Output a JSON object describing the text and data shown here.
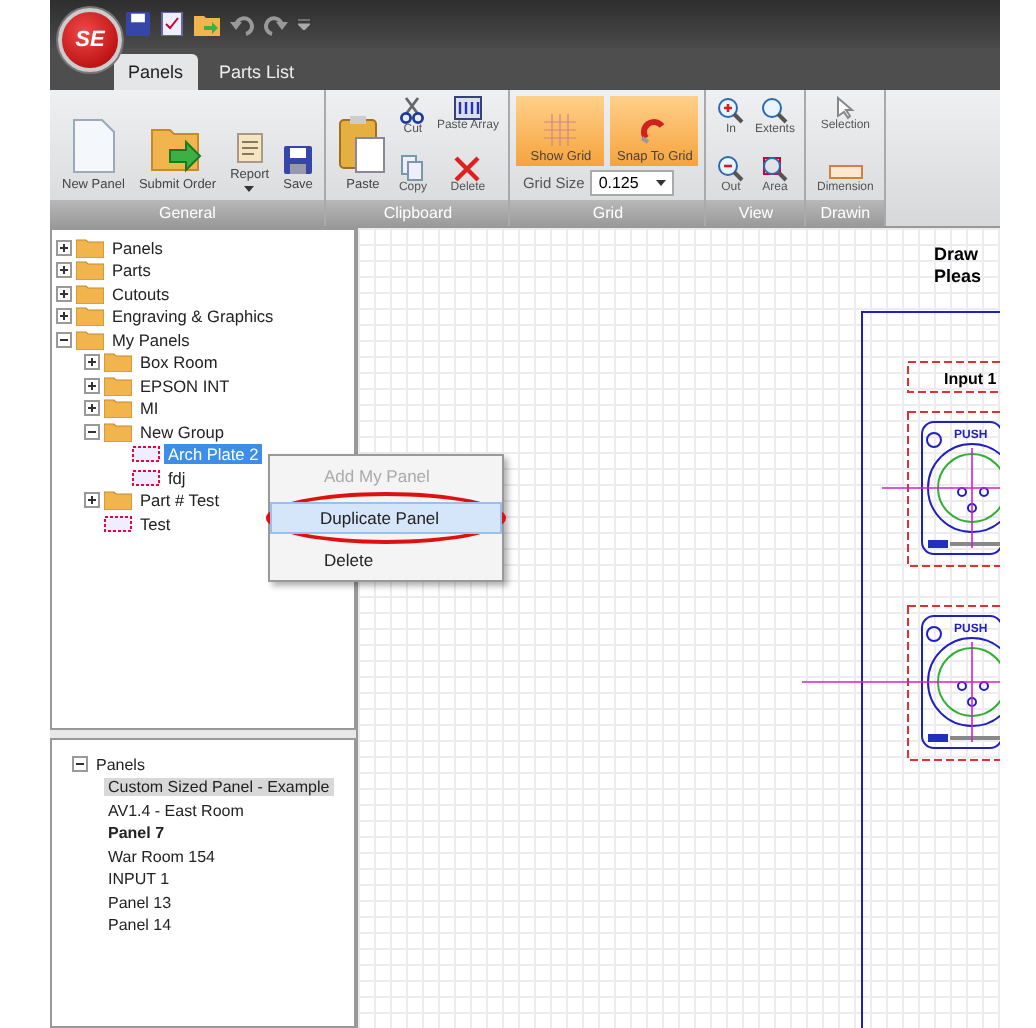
{
  "app": {
    "logo": "SE"
  },
  "ribbon_tabs": [
    {
      "label": "Panels",
      "selected": true
    },
    {
      "label": "Parts List",
      "selected": false
    }
  ],
  "ribbon_groups": [
    {
      "label": "General",
      "buttons": [
        {
          "label": "New Panel",
          "kind": "large"
        },
        {
          "label": "Submit Order",
          "kind": "large"
        },
        {
          "label": "Report",
          "kind": "menu"
        },
        {
          "label": "Save",
          "kind": "large"
        }
      ]
    },
    {
      "label": "Clipboard",
      "buttons": [
        {
          "label": "Paste",
          "kind": "large"
        },
        {
          "label": "Cut",
          "kind": "small"
        },
        {
          "label": "Copy",
          "kind": "small"
        },
        {
          "label": "Paste Array",
          "kind": "small"
        },
        {
          "label": "Delete",
          "kind": "small"
        }
      ]
    },
    {
      "label": "Grid",
      "buttons": [
        {
          "label": "Show Grid",
          "kind": "toggle",
          "on": true
        },
        {
          "label": "Snap To Grid",
          "kind": "toggle",
          "on": true
        }
      ],
      "grid_size": {
        "label": "Grid Size",
        "value": "0.125"
      }
    },
    {
      "label": "View",
      "buttons": [
        {
          "label": "In",
          "kind": "small"
        },
        {
          "label": "Out",
          "kind": "small"
        },
        {
          "label": "Extents",
          "kind": "small"
        },
        {
          "label": "Area",
          "kind": "small"
        }
      ]
    },
    {
      "label": "Drawin",
      "buttons": [
        {
          "label": "Selection",
          "kind": "small"
        },
        {
          "label": "Dimension",
          "kind": "small"
        }
      ]
    }
  ],
  "library_tree": [
    {
      "label": "Panels",
      "kind": "folder",
      "expanded": false,
      "selected": false
    },
    {
      "label": "Parts",
      "kind": "folder",
      "expanded": false,
      "selected": false
    },
    {
      "label": "Cutouts",
      "kind": "folder",
      "expanded": false,
      "selected": false
    },
    {
      "label": "Engraving & Graphics",
      "kind": "folder",
      "expanded": false,
      "selected": false
    },
    {
      "label": "My Panels",
      "kind": "folder",
      "expanded": true,
      "selected": false,
      "children": [
        {
          "label": "Box Room",
          "kind": "folder",
          "expanded": false,
          "selected": false
        },
        {
          "label": "EPSON INT",
          "kind": "folder",
          "expanded": false,
          "selected": false
        },
        {
          "label": "MI",
          "kind": "folder",
          "expanded": false,
          "selected": false
        },
        {
          "label": "New Group",
          "kind": "folder",
          "expanded": true,
          "selected": false,
          "children": [
            {
              "label": "Arch Plate 2",
              "kind": "panel",
              "selected": true
            },
            {
              "label": "fdj",
              "kind": "panel",
              "selected": false
            }
          ]
        },
        {
          "label": "Part # Test",
          "kind": "folder",
          "expanded": false,
          "selected": false
        },
        {
          "label": "Test",
          "kind": "panel",
          "selected": false
        }
      ]
    }
  ],
  "context_menu": [
    {
      "label": "Add My Panel",
      "disabled": true,
      "selected": false
    },
    {
      "label": "Duplicate Panel",
      "disabled": false,
      "selected": true,
      "annotated": true
    },
    {
      "label": "Delete",
      "disabled": false,
      "selected": false
    }
  ],
  "panels_tree": {
    "label": "Panels",
    "expanded": true,
    "children": [
      {
        "label": "Custom Sized Panel - Example",
        "selected": true,
        "bold": false
      },
      {
        "label": "AV1.4 - East Room",
        "selected": false,
        "bold": false
      },
      {
        "label": "Panel 7",
        "selected": false,
        "bold": true
      },
      {
        "label": "War Room 154",
        "selected": false,
        "bold": false
      },
      {
        "label": "INPUT 1",
        "selected": false,
        "bold": false
      },
      {
        "label": "Panel 13",
        "selected": false,
        "bold": false
      },
      {
        "label": "Panel 14",
        "selected": false,
        "bold": false
      }
    ]
  },
  "canvas": {
    "notes": [
      "Draw",
      "Pleas"
    ],
    "group_label": "Input 1",
    "connectors": [
      {
        "label": "PUSH"
      },
      {
        "label": "PUSH"
      }
    ]
  }
}
